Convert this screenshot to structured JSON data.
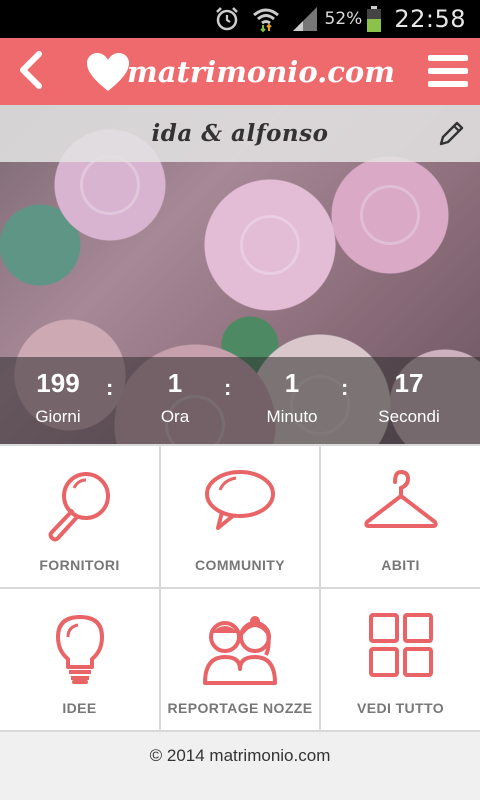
{
  "status_bar": {
    "battery_percent": "52%",
    "time": "22:58",
    "icons": [
      "alarm-icon",
      "wifi-icon",
      "signal-icon",
      "battery-icon"
    ]
  },
  "header": {
    "brand": "matrimonio.com",
    "accent_color": "#ef6a6d",
    "back_icon": "chevron-left-icon",
    "menu_icon": "hamburger-menu-icon"
  },
  "couple": {
    "name": "ida & alfonso",
    "edit_icon": "pencil-icon"
  },
  "countdown": [
    {
      "value": "199",
      "label": "Giorni"
    },
    {
      "value": "1",
      "label": "Ora"
    },
    {
      "value": "1",
      "label": "Minuto"
    },
    {
      "value": "17",
      "label": "Secondi"
    }
  ],
  "tiles": [
    {
      "label": "FORNITORI",
      "icon": "magnifier-icon"
    },
    {
      "label": "COMMUNITY",
      "icon": "speech-bubble-icon"
    },
    {
      "label": "ABITI",
      "icon": "hanger-icon"
    },
    {
      "label": "IDEE",
      "icon": "lightbulb-icon"
    },
    {
      "label": "REPORTAGE NOZZE",
      "icon": "couple-icon"
    },
    {
      "label": "VEDI TUTTO",
      "icon": "grid-icon"
    }
  ],
  "footer": {
    "copyright": "© 2014 matrimonio.com"
  }
}
